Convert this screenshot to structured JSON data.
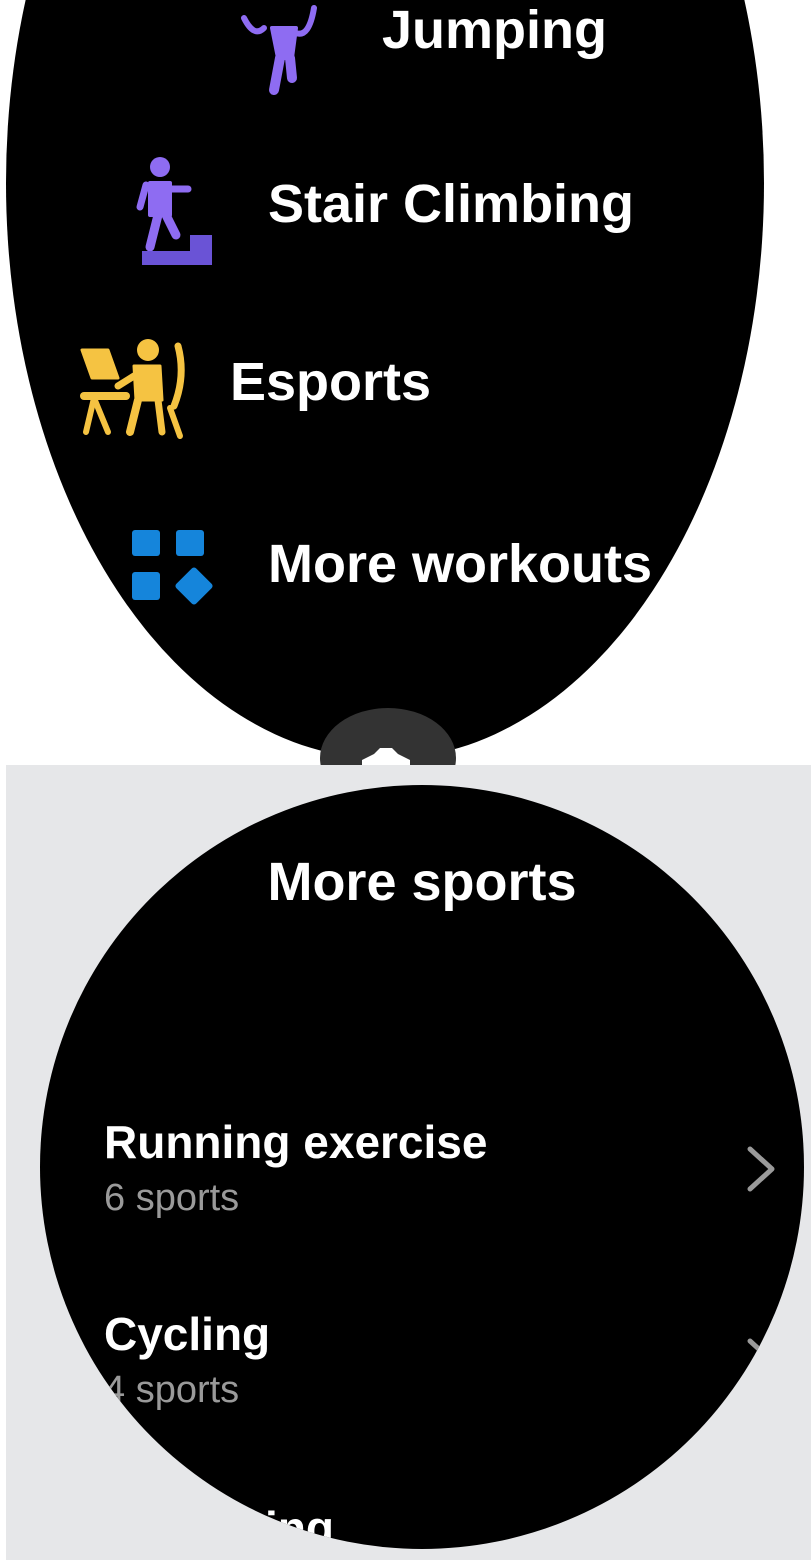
{
  "top_screen": {
    "items": [
      {
        "label": "Jumping",
        "icon": "jump-rope-icon",
        "color": "#8e6cf2"
      },
      {
        "label": "Stair Climbing",
        "icon": "stair-climbing-icon",
        "color": "#8e6cf2"
      },
      {
        "label": "Esports",
        "icon": "esports-icon",
        "color": "#f5c342"
      },
      {
        "label": "More workouts",
        "icon": "more-workouts-icon",
        "color": "#1585db"
      }
    ],
    "scroll_handle_icon": "scroll-up-handle-icon"
  },
  "bottom_screen": {
    "title": "More sports",
    "categories": [
      {
        "title": "Running exercise",
        "subtitle": "6 sports",
        "chevron": "chevron-right-icon"
      },
      {
        "title": "Cycling",
        "subtitle": "4 sports",
        "chevron": "chevron-right-icon"
      },
      {
        "title": "Swimming",
        "subtitle": "",
        "chevron": "chevron-right-icon"
      }
    ]
  },
  "colors": {
    "screen_bg": "#000000",
    "frame_bg": "#e6e7e9",
    "text_primary": "#ffffff",
    "text_secondary": "#9a9a9a",
    "accent_purple": "#8e6cf2",
    "accent_yellow": "#f5c342",
    "accent_blue": "#1585db"
  }
}
